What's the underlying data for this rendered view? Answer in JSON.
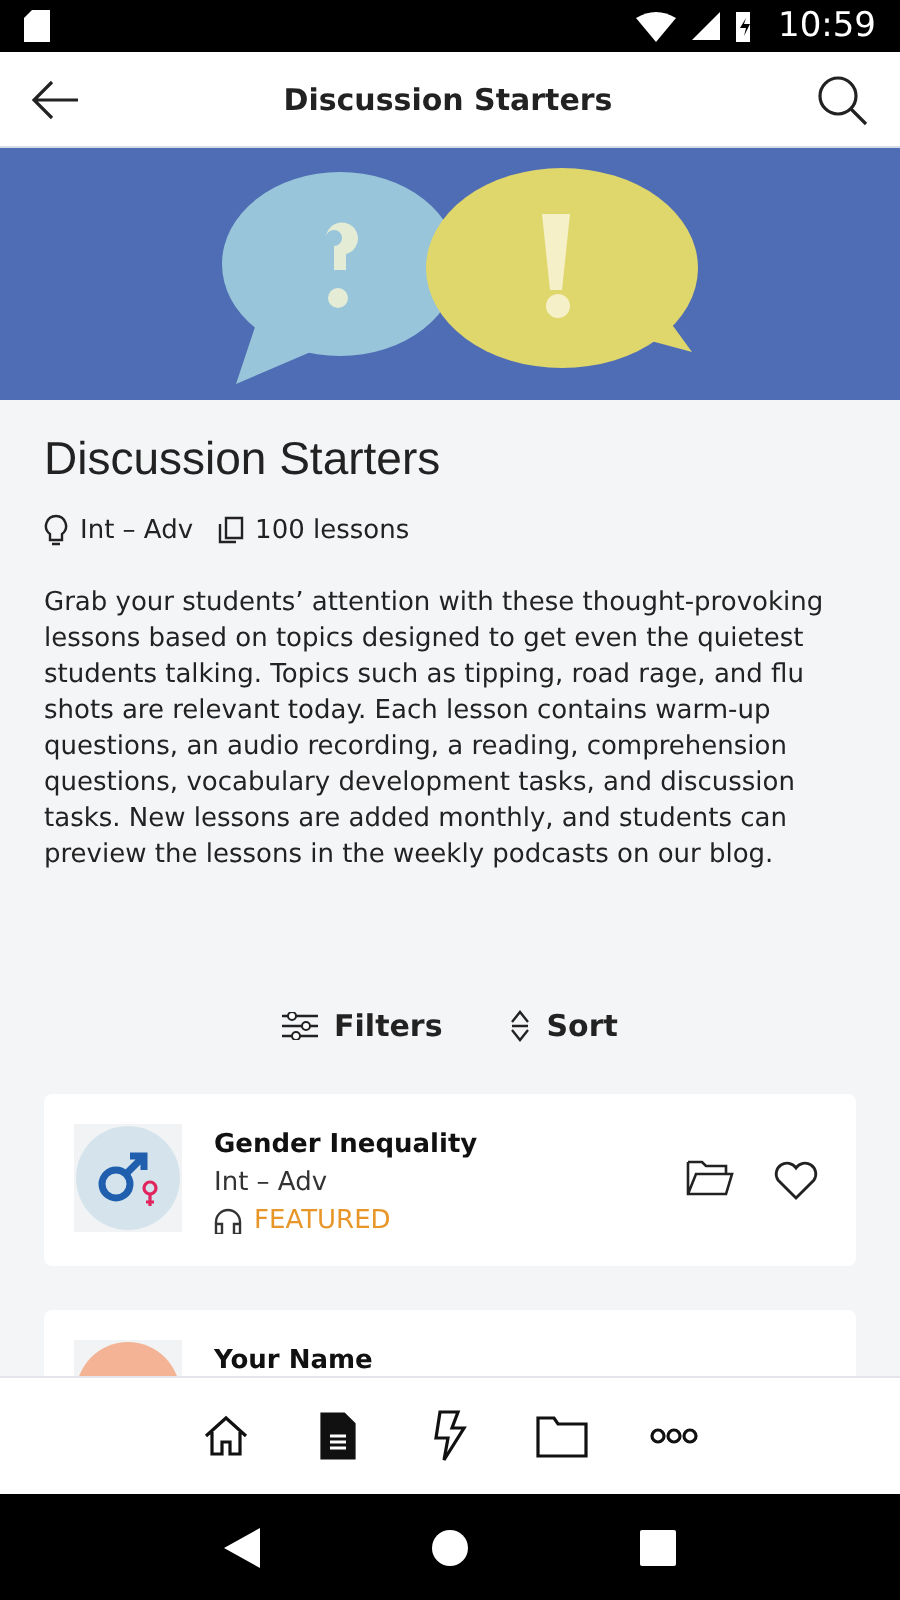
{
  "status_bar": {
    "time": "10:59"
  },
  "app_bar": {
    "title": "Discussion Starters"
  },
  "course": {
    "title": "Discussion Starters",
    "level": "Int – Adv",
    "lessons": "100 lessons",
    "description": "Grab your students’ attention with these thought-provoking lessons based on topics designed to get even the quietest students talking. Topics such as tipping, road rage, and flu shots are relevant today. Each lesson contains warm-up questions, an audio recording, a reading, comprehension questions, vocabulary development tasks, and discussion tasks. New lessons are added monthly, and students can preview the lessons in the weekly podcasts on our blog."
  },
  "controls": {
    "filters": "Filters",
    "sort": "Sort"
  },
  "lessons": [
    {
      "title": "Gender Inequality",
      "level": "Int – Adv",
      "badge": "FEATURED",
      "favorite": false,
      "color": "#d5e3ec"
    },
    {
      "title": "Your Name",
      "color": "#f4b395"
    }
  ],
  "bottom_nav": [
    {
      "kind": "home",
      "selected": false
    },
    {
      "kind": "lessons",
      "selected": true
    },
    {
      "kind": "flash",
      "selected": false
    },
    {
      "kind": "folder",
      "selected": false
    },
    {
      "kind": "more",
      "selected": false
    }
  ]
}
